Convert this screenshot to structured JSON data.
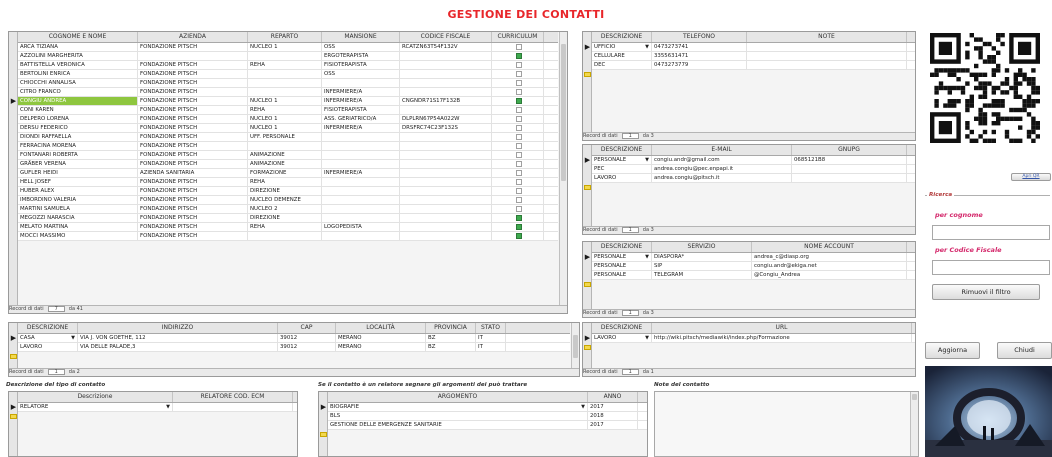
{
  "title": "GESTIONE DEI CONTATTI",
  "contacts": {
    "columns": [
      "COGNOME E NOME",
      "AZIENDA",
      "REPARTO",
      "MANSIONE",
      "CODICE FISCALE",
      "CURRICULUM"
    ],
    "rows": [
      [
        "ARCA TIZIANA",
        "FONDAZIONE PITSCH",
        "NUCLEO 1",
        "OSS",
        "RCATZN63T54F132V",
        false
      ],
      [
        "AZZOLINI MARGHERITA",
        "",
        "",
        "ERGOTERAPISTA",
        "",
        true
      ],
      [
        "BATTISTELLA VERONICA",
        "FONDAZIONE PITSCH",
        "REHA",
        "FISIOTERAPISTA",
        "",
        false
      ],
      [
        "BERTOLINI ENRICA",
        "FONDAZIONE PITSCH",
        "",
        "OSS",
        "",
        false
      ],
      [
        "CHIOCCHI ANNALISA",
        "FONDAZIONE PITSCH",
        "",
        "",
        "",
        false
      ],
      [
        "CITRO FRANCO",
        "FONDAZIONE PITSCH",
        "",
        "INFERMIERE/A",
        "",
        false
      ],
      [
        "CONGIU ANDREA",
        "FONDAZIONE PITSCH",
        "NUCLEO 1",
        "INFERMIERE/A",
        "CNGNDR71S17F132B",
        true
      ],
      [
        "CONI KAREN",
        "FONDAZIONE PITSCH",
        "REHA",
        "FISIOTERAPISTA",
        "",
        false
      ],
      [
        "DELPERO LORENA",
        "FONDAZIONE PITSCH",
        "NUCLEO 1",
        "ASS. GERIATRICO/A",
        "DLPLRN67P54A022W",
        false
      ],
      [
        "DERSU FEDERICO",
        "FONDAZIONE PITSCH",
        "NUCLEO 1",
        "INFERMIERE/A",
        "DRSFRC74C23F132S",
        false
      ],
      [
        "DIONDI RAFFAELLA",
        "FONDAZIONE PITSCH",
        "UFF. PERSONALE",
        "",
        "",
        false
      ],
      [
        "FERRACINA MORENA",
        "FONDAZIONE PITSCH",
        "",
        "",
        "",
        false
      ],
      [
        "FONTANARI ROBERTA",
        "FONDAZIONE PITSCH",
        "ANIMAZIONE",
        "",
        "",
        false
      ],
      [
        "GRÄBER VERENA",
        "FONDAZIONE PITSCH",
        "ANIMAZIONE",
        "",
        "",
        false
      ],
      [
        "GUFLER HEIDI",
        "AZIENDA SANITARIA",
        "FORMAZIONE",
        "INFERMIERE/A",
        "",
        false
      ],
      [
        "HELL JOSEF",
        "FONDAZIONE PITSCH",
        "REHA",
        "",
        "",
        false
      ],
      [
        "HUBER ALEX",
        "FONDAZIONE PITSCH",
        "DIREZIONE",
        "",
        "",
        false
      ],
      [
        "IMBORDINO VALERIA",
        "FONDAZIONE PITSCH",
        "NUCLEO DEMENZE",
        "",
        "",
        false
      ],
      [
        "MARTINI SAMUELA",
        "FONDAZIONE PITSCH",
        "NUCLEO 2",
        "",
        "",
        false
      ],
      [
        "MEGOZZI NARASCIA",
        "FONDAZIONE PITSCH",
        "DIREZIONE",
        "",
        "",
        true
      ],
      [
        "MELATO MARTINA",
        "FONDAZIONE PITSCH",
        "REHA",
        "LOGOPEDISTA",
        "",
        true
      ],
      [
        "MOCCI MASSIMO",
        "FONDAZIONE PITSCH",
        "",
        "",
        "",
        true
      ]
    ],
    "nav": {
      "label": "Record di dati",
      "current": "7",
      "of": "da 41"
    }
  },
  "phones": {
    "columns": [
      "DESCRIZIONE",
      "TELEFONO",
      "NOTE"
    ],
    "rows": [
      [
        "UFFICIO",
        "0473273741",
        ""
      ],
      [
        "CELLULARE",
        "3355631471",
        ""
      ],
      [
        "DEC",
        "0473273779",
        ""
      ]
    ],
    "nav": {
      "label": "Record di dati",
      "current": "1",
      "of": "da 3"
    }
  },
  "emails": {
    "columns": [
      "DESCRIZIONE",
      "E-MAIL",
      "GNUPG"
    ],
    "rows": [
      [
        "PERSONALE",
        "congiu.andr@gmail.com",
        "0685121B8"
      ],
      [
        "PEC",
        "andrea.congiu@pec.enpapi.it",
        ""
      ],
      [
        "LAVORO",
        "andrea.congiu@pitsch.it",
        ""
      ]
    ],
    "nav": {
      "label": "Record di dati",
      "current": "1",
      "of": "da 3"
    }
  },
  "services": {
    "columns": [
      "DESCRIZIONE",
      "SERVIZIO",
      "NOME ACCOUNT"
    ],
    "rows": [
      [
        "PERSONALE",
        "DIASPORA*",
        "andrea_c@diasp.org"
      ],
      [
        "PERSONALE",
        "SIP",
        "congiu.andr@ekiga.net"
      ],
      [
        "PERSONALE",
        "TELEGRAM",
        "@Congiu_Andrea"
      ]
    ],
    "nav": {
      "label": "Record di dati",
      "current": "1",
      "of": "da 3"
    }
  },
  "addresses": {
    "columns": [
      "DESCRIZIONE",
      "INDIRIZZO",
      "CAP",
      "LOCALITÀ",
      "PROVINCIA",
      "STATO"
    ],
    "rows": [
      [
        "CASA",
        "VIA J. VON GOETHE, 112",
        "39012",
        "MERANO",
        "BZ",
        "IT"
      ],
      [
        "LAVORO",
        "VIA DELLE PALADE,3",
        "39012",
        "MERANO",
        "BZ",
        "IT"
      ]
    ],
    "nav": {
      "label": "Record di dati",
      "current": "1",
      "of": "da 2"
    }
  },
  "urls": {
    "columns": [
      "DESCRIZIONE",
      "URL"
    ],
    "rows": [
      [
        "LAVORO",
        "http://wiki.pitsch/mediawiki/index.php/Formazione"
      ]
    ],
    "nav": {
      "label": "Record di dati",
      "current": "1",
      "of": "da 1"
    }
  },
  "contact_type": {
    "label": "Descrizione del tipo di contatto",
    "columns": [
      "Descrizione",
      "RELATORE COD. ECM"
    ],
    "rows": [
      [
        "RELATORE",
        ""
      ]
    ]
  },
  "topics": {
    "label": "Se il contatto è un relatore segnare gli argomenti dei può trattare",
    "columns": [
      "ARGOMENTO",
      "ANNO"
    ],
    "rows": [
      [
        "BIOGRAFIE",
        "2017"
      ],
      [
        "BLS",
        "2018"
      ],
      [
        "GESTIONE DELLE EMERGENZE SANITARIE",
        "2017"
      ]
    ]
  },
  "notes": {
    "label": "Note del contatto"
  },
  "search": {
    "group_label": "Ricerca",
    "by_surname": "per cognome",
    "by_cf": "per Codice Fiscale",
    "remove_filter": "Rimuovi il filtro",
    "small_btn": "Apri QR"
  },
  "buttons": {
    "update": "Aggiorna",
    "close": "Chiudi"
  },
  "colors": {
    "title": "#e8262a",
    "highlight": "#8ec63f",
    "checkbox_on": "#3faa4f"
  }
}
